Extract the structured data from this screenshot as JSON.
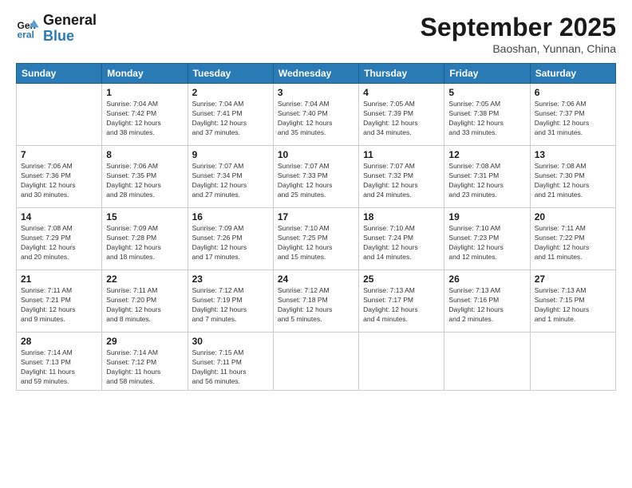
{
  "logo": {
    "line1": "General",
    "line2": "Blue"
  },
  "title": "September 2025",
  "subtitle": "Baoshan, Yunnan, China",
  "days_of_week": [
    "Sunday",
    "Monday",
    "Tuesday",
    "Wednesday",
    "Thursday",
    "Friday",
    "Saturday"
  ],
  "weeks": [
    [
      {
        "day": "",
        "info": ""
      },
      {
        "day": "1",
        "info": "Sunrise: 7:04 AM\nSunset: 7:42 PM\nDaylight: 12 hours\nand 38 minutes."
      },
      {
        "day": "2",
        "info": "Sunrise: 7:04 AM\nSunset: 7:41 PM\nDaylight: 12 hours\nand 37 minutes."
      },
      {
        "day": "3",
        "info": "Sunrise: 7:04 AM\nSunset: 7:40 PM\nDaylight: 12 hours\nand 35 minutes."
      },
      {
        "day": "4",
        "info": "Sunrise: 7:05 AM\nSunset: 7:39 PM\nDaylight: 12 hours\nand 34 minutes."
      },
      {
        "day": "5",
        "info": "Sunrise: 7:05 AM\nSunset: 7:38 PM\nDaylight: 12 hours\nand 33 minutes."
      },
      {
        "day": "6",
        "info": "Sunrise: 7:06 AM\nSunset: 7:37 PM\nDaylight: 12 hours\nand 31 minutes."
      }
    ],
    [
      {
        "day": "7",
        "info": "Sunrise: 7:06 AM\nSunset: 7:36 PM\nDaylight: 12 hours\nand 30 minutes."
      },
      {
        "day": "8",
        "info": "Sunrise: 7:06 AM\nSunset: 7:35 PM\nDaylight: 12 hours\nand 28 minutes."
      },
      {
        "day": "9",
        "info": "Sunrise: 7:07 AM\nSunset: 7:34 PM\nDaylight: 12 hours\nand 27 minutes."
      },
      {
        "day": "10",
        "info": "Sunrise: 7:07 AM\nSunset: 7:33 PM\nDaylight: 12 hours\nand 25 minutes."
      },
      {
        "day": "11",
        "info": "Sunrise: 7:07 AM\nSunset: 7:32 PM\nDaylight: 12 hours\nand 24 minutes."
      },
      {
        "day": "12",
        "info": "Sunrise: 7:08 AM\nSunset: 7:31 PM\nDaylight: 12 hours\nand 23 minutes."
      },
      {
        "day": "13",
        "info": "Sunrise: 7:08 AM\nSunset: 7:30 PM\nDaylight: 12 hours\nand 21 minutes."
      }
    ],
    [
      {
        "day": "14",
        "info": "Sunrise: 7:08 AM\nSunset: 7:29 PM\nDaylight: 12 hours\nand 20 minutes."
      },
      {
        "day": "15",
        "info": "Sunrise: 7:09 AM\nSunset: 7:28 PM\nDaylight: 12 hours\nand 18 minutes."
      },
      {
        "day": "16",
        "info": "Sunrise: 7:09 AM\nSunset: 7:26 PM\nDaylight: 12 hours\nand 17 minutes."
      },
      {
        "day": "17",
        "info": "Sunrise: 7:10 AM\nSunset: 7:25 PM\nDaylight: 12 hours\nand 15 minutes."
      },
      {
        "day": "18",
        "info": "Sunrise: 7:10 AM\nSunset: 7:24 PM\nDaylight: 12 hours\nand 14 minutes."
      },
      {
        "day": "19",
        "info": "Sunrise: 7:10 AM\nSunset: 7:23 PM\nDaylight: 12 hours\nand 12 minutes."
      },
      {
        "day": "20",
        "info": "Sunrise: 7:11 AM\nSunset: 7:22 PM\nDaylight: 12 hours\nand 11 minutes."
      }
    ],
    [
      {
        "day": "21",
        "info": "Sunrise: 7:11 AM\nSunset: 7:21 PM\nDaylight: 12 hours\nand 9 minutes."
      },
      {
        "day": "22",
        "info": "Sunrise: 7:11 AM\nSunset: 7:20 PM\nDaylight: 12 hours\nand 8 minutes."
      },
      {
        "day": "23",
        "info": "Sunrise: 7:12 AM\nSunset: 7:19 PM\nDaylight: 12 hours\nand 7 minutes."
      },
      {
        "day": "24",
        "info": "Sunrise: 7:12 AM\nSunset: 7:18 PM\nDaylight: 12 hours\nand 5 minutes."
      },
      {
        "day": "25",
        "info": "Sunrise: 7:13 AM\nSunset: 7:17 PM\nDaylight: 12 hours\nand 4 minutes."
      },
      {
        "day": "26",
        "info": "Sunrise: 7:13 AM\nSunset: 7:16 PM\nDaylight: 12 hours\nand 2 minutes."
      },
      {
        "day": "27",
        "info": "Sunrise: 7:13 AM\nSunset: 7:15 PM\nDaylight: 12 hours\nand 1 minute."
      }
    ],
    [
      {
        "day": "28",
        "info": "Sunrise: 7:14 AM\nSunset: 7:13 PM\nDaylight: 11 hours\nand 59 minutes."
      },
      {
        "day": "29",
        "info": "Sunrise: 7:14 AM\nSunset: 7:12 PM\nDaylight: 11 hours\nand 58 minutes."
      },
      {
        "day": "30",
        "info": "Sunrise: 7:15 AM\nSunset: 7:11 PM\nDaylight: 11 hours\nand 56 minutes."
      },
      {
        "day": "",
        "info": ""
      },
      {
        "day": "",
        "info": ""
      },
      {
        "day": "",
        "info": ""
      },
      {
        "day": "",
        "info": ""
      }
    ]
  ]
}
